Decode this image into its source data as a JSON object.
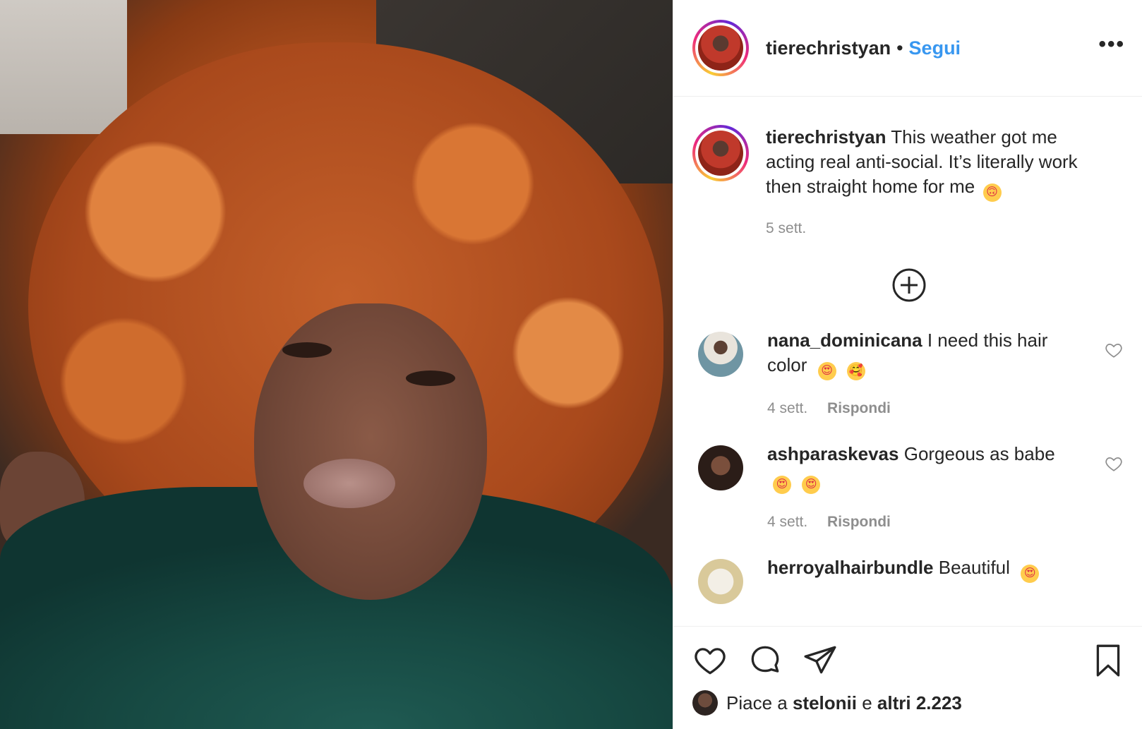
{
  "post": {
    "author": "tierechristyan",
    "separator": "•",
    "follow_label": "Segui",
    "more_label": "•••"
  },
  "caption": {
    "username": "tierechristyan",
    "text": "This weather got me acting real anti-social. It’s literally work then straight home for me",
    "emoji": "🙃",
    "time": "5 sett."
  },
  "comments": [
    {
      "username": "nana_dominicana",
      "text": "I need this hair color",
      "emojis": [
        "😍",
        "🥰"
      ],
      "time": "4 sett.",
      "reply_label": "Rispondi"
    },
    {
      "username": "ashparaskevas",
      "text": "Gorgeous as babe",
      "emojis": [
        "😍",
        "😍"
      ],
      "time": "4 sett.",
      "reply_label": "Rispondi"
    },
    {
      "username": "herroyalhairbundle",
      "text": "Beautiful",
      "emojis": [
        "😍"
      ]
    }
  ],
  "likes": {
    "prefix": "Piace a",
    "user": "stelonii",
    "conjunction": "e",
    "others": "altri 2.223"
  },
  "colors": {
    "follow_blue": "#3897f0",
    "text_dark": "#262626",
    "text_muted": "#8e8e8e",
    "border": "#efefef"
  },
  "icons": [
    "more-options-icon",
    "load-more-plus-icon",
    "heart-outline-icon",
    "like-icon",
    "comment-icon",
    "share-icon",
    "save-icon"
  ]
}
